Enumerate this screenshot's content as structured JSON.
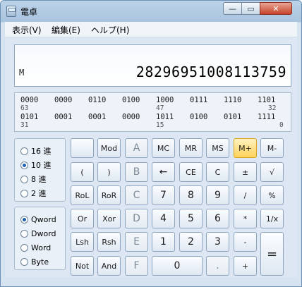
{
  "window": {
    "title": "電卓",
    "min_label": "—",
    "max_label": "▭",
    "close_label": "✕"
  },
  "menu": [
    "表示(V)",
    "編集(E)",
    "ヘルプ(H)"
  ],
  "display": {
    "memory_indicator": "M",
    "value": "28296951008113759"
  },
  "bits": {
    "row1": [
      "0000",
      "0000",
      "0110",
      "0100",
      "1000",
      "0111",
      "1110",
      "1101"
    ],
    "row1_labels": [
      "63",
      "47",
      "32"
    ],
    "row2": [
      "0101",
      "0001",
      "0001",
      "0000",
      "1011",
      "0100",
      "0101",
      "1111"
    ],
    "row2_labels": [
      "31",
      "15",
      "0"
    ]
  },
  "base_modes": [
    "16 進",
    "10 進",
    "8 進",
    "2 進"
  ],
  "word_sizes": [
    "Qword",
    "Dword",
    "Word",
    "Byte"
  ],
  "keys": {
    "row1": [
      "",
      "Mod",
      "A",
      "MC",
      "MR",
      "MS",
      "M+",
      "M-"
    ],
    "row2": [
      "(",
      ")",
      "B",
      "←",
      "CE",
      "C",
      "±",
      "√"
    ],
    "row3": [
      "RoL",
      "RoR",
      "C",
      "7",
      "8",
      "9",
      "/",
      "%"
    ],
    "row4": [
      "Or",
      "Xor",
      "D",
      "4",
      "5",
      "6",
      "*",
      "1/x"
    ],
    "row5": [
      "Lsh",
      "Rsh",
      "E",
      "1",
      "2",
      "3",
      "-",
      "="
    ],
    "row6": [
      "Not",
      "And",
      "F",
      "0",
      ".",
      "+"
    ]
  },
  "state": {
    "selected_base": "10 進",
    "selected_word": "Qword",
    "highlighted_key": "M+"
  }
}
